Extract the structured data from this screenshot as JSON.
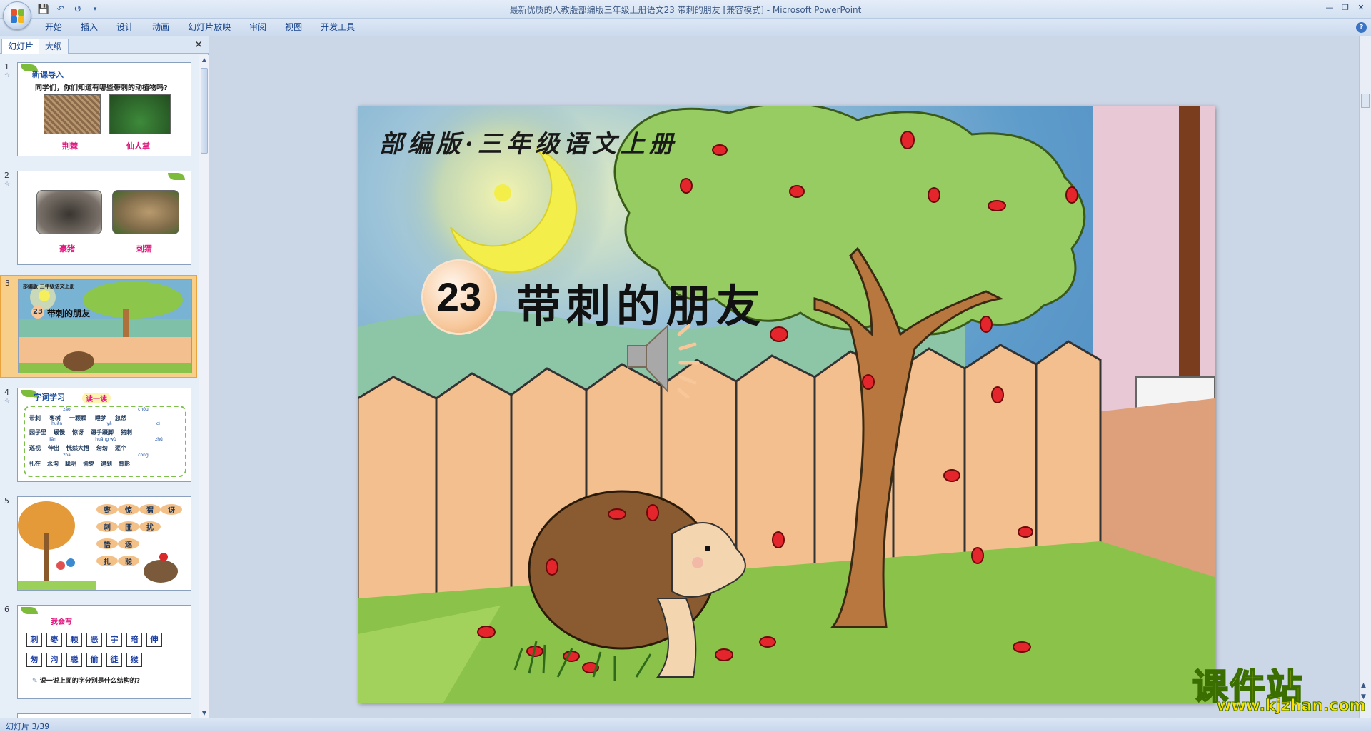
{
  "window": {
    "title": "最新优质的人教版部编版三年级上册语文23 带刺的朋友 [兼容模式] - Microsoft PowerPoint"
  },
  "qat": {
    "save_icon": "save-icon",
    "undo_icon": "undo-icon",
    "redo_icon": "redo-icon",
    "customize_icon": "chevron-down-icon"
  },
  "ribbon": {
    "tabs": [
      "开始",
      "插入",
      "设计",
      "动画",
      "幻灯片放映",
      "审阅",
      "视图",
      "开发工具"
    ]
  },
  "left_pane": {
    "tabs": [
      "幻灯片",
      "大纲"
    ],
    "slides": [
      {
        "num": "1",
        "heading": "新课导入",
        "question": "同学们，你们知道有哪些带刺的动植物吗?",
        "captions": [
          "荆棘",
          "仙人掌"
        ]
      },
      {
        "num": "2",
        "captions": [
          "豪猪",
          "刺猬"
        ]
      },
      {
        "num": "3",
        "subtitle": "部编版·三年级语文上册",
        "badge": "23",
        "title": "带刺的朋友"
      },
      {
        "num": "4",
        "heading": "字词学习",
        "tag": "读一读",
        "rows": [
          [
            "带刺",
            "枣树",
            "一颗颗",
            "睡梦",
            "忽然"
          ],
          [
            "园子里",
            "缓慢",
            "惊讶",
            "蹑手蹑脚",
            "猪刺"
          ],
          [
            "巡视",
            "伸出",
            "恍然大悟",
            "匆匆",
            "逐个"
          ],
          [
            "扎在",
            "水沟",
            "聪明",
            "偷枣",
            "逮到",
            "背影"
          ]
        ],
        "pinyin": [
          "zǎo",
          "chǒu",
          "huǎn",
          "yà",
          "cì",
          "jiān",
          "huǎng wù",
          "zhú",
          "zhā",
          "cōng"
        ]
      },
      {
        "num": "5",
        "chars": [
          "枣",
          "惊",
          "猬",
          "讶",
          "刺",
          "匪",
          "扰",
          "悟",
          "逐",
          "扎",
          "聪"
        ]
      },
      {
        "num": "6",
        "heading": "我会写",
        "chars_row1": [
          "刺",
          "枣",
          "颗",
          "恶",
          "宇",
          "暗",
          "伸"
        ],
        "chars_row2": [
          "匆",
          "沟",
          "聪",
          "偷",
          "徒",
          "猴"
        ],
        "question": "说一说上面的字分别是什么结构的?"
      }
    ]
  },
  "slide": {
    "subtitle": "部编版·三年级语文上册",
    "badge": "23",
    "title": "带刺的朋友",
    "speaker_icon": "speaker-icon"
  },
  "watermark": {
    "text": "课件站",
    "url": "www.kjzhan.com"
  },
  "status": {
    "slide_counter": "幻灯片 3/39"
  },
  "colors": {
    "selected_thumb": "#f8cf8a",
    "title_text": "#111111",
    "watermark": "#ffe000"
  }
}
